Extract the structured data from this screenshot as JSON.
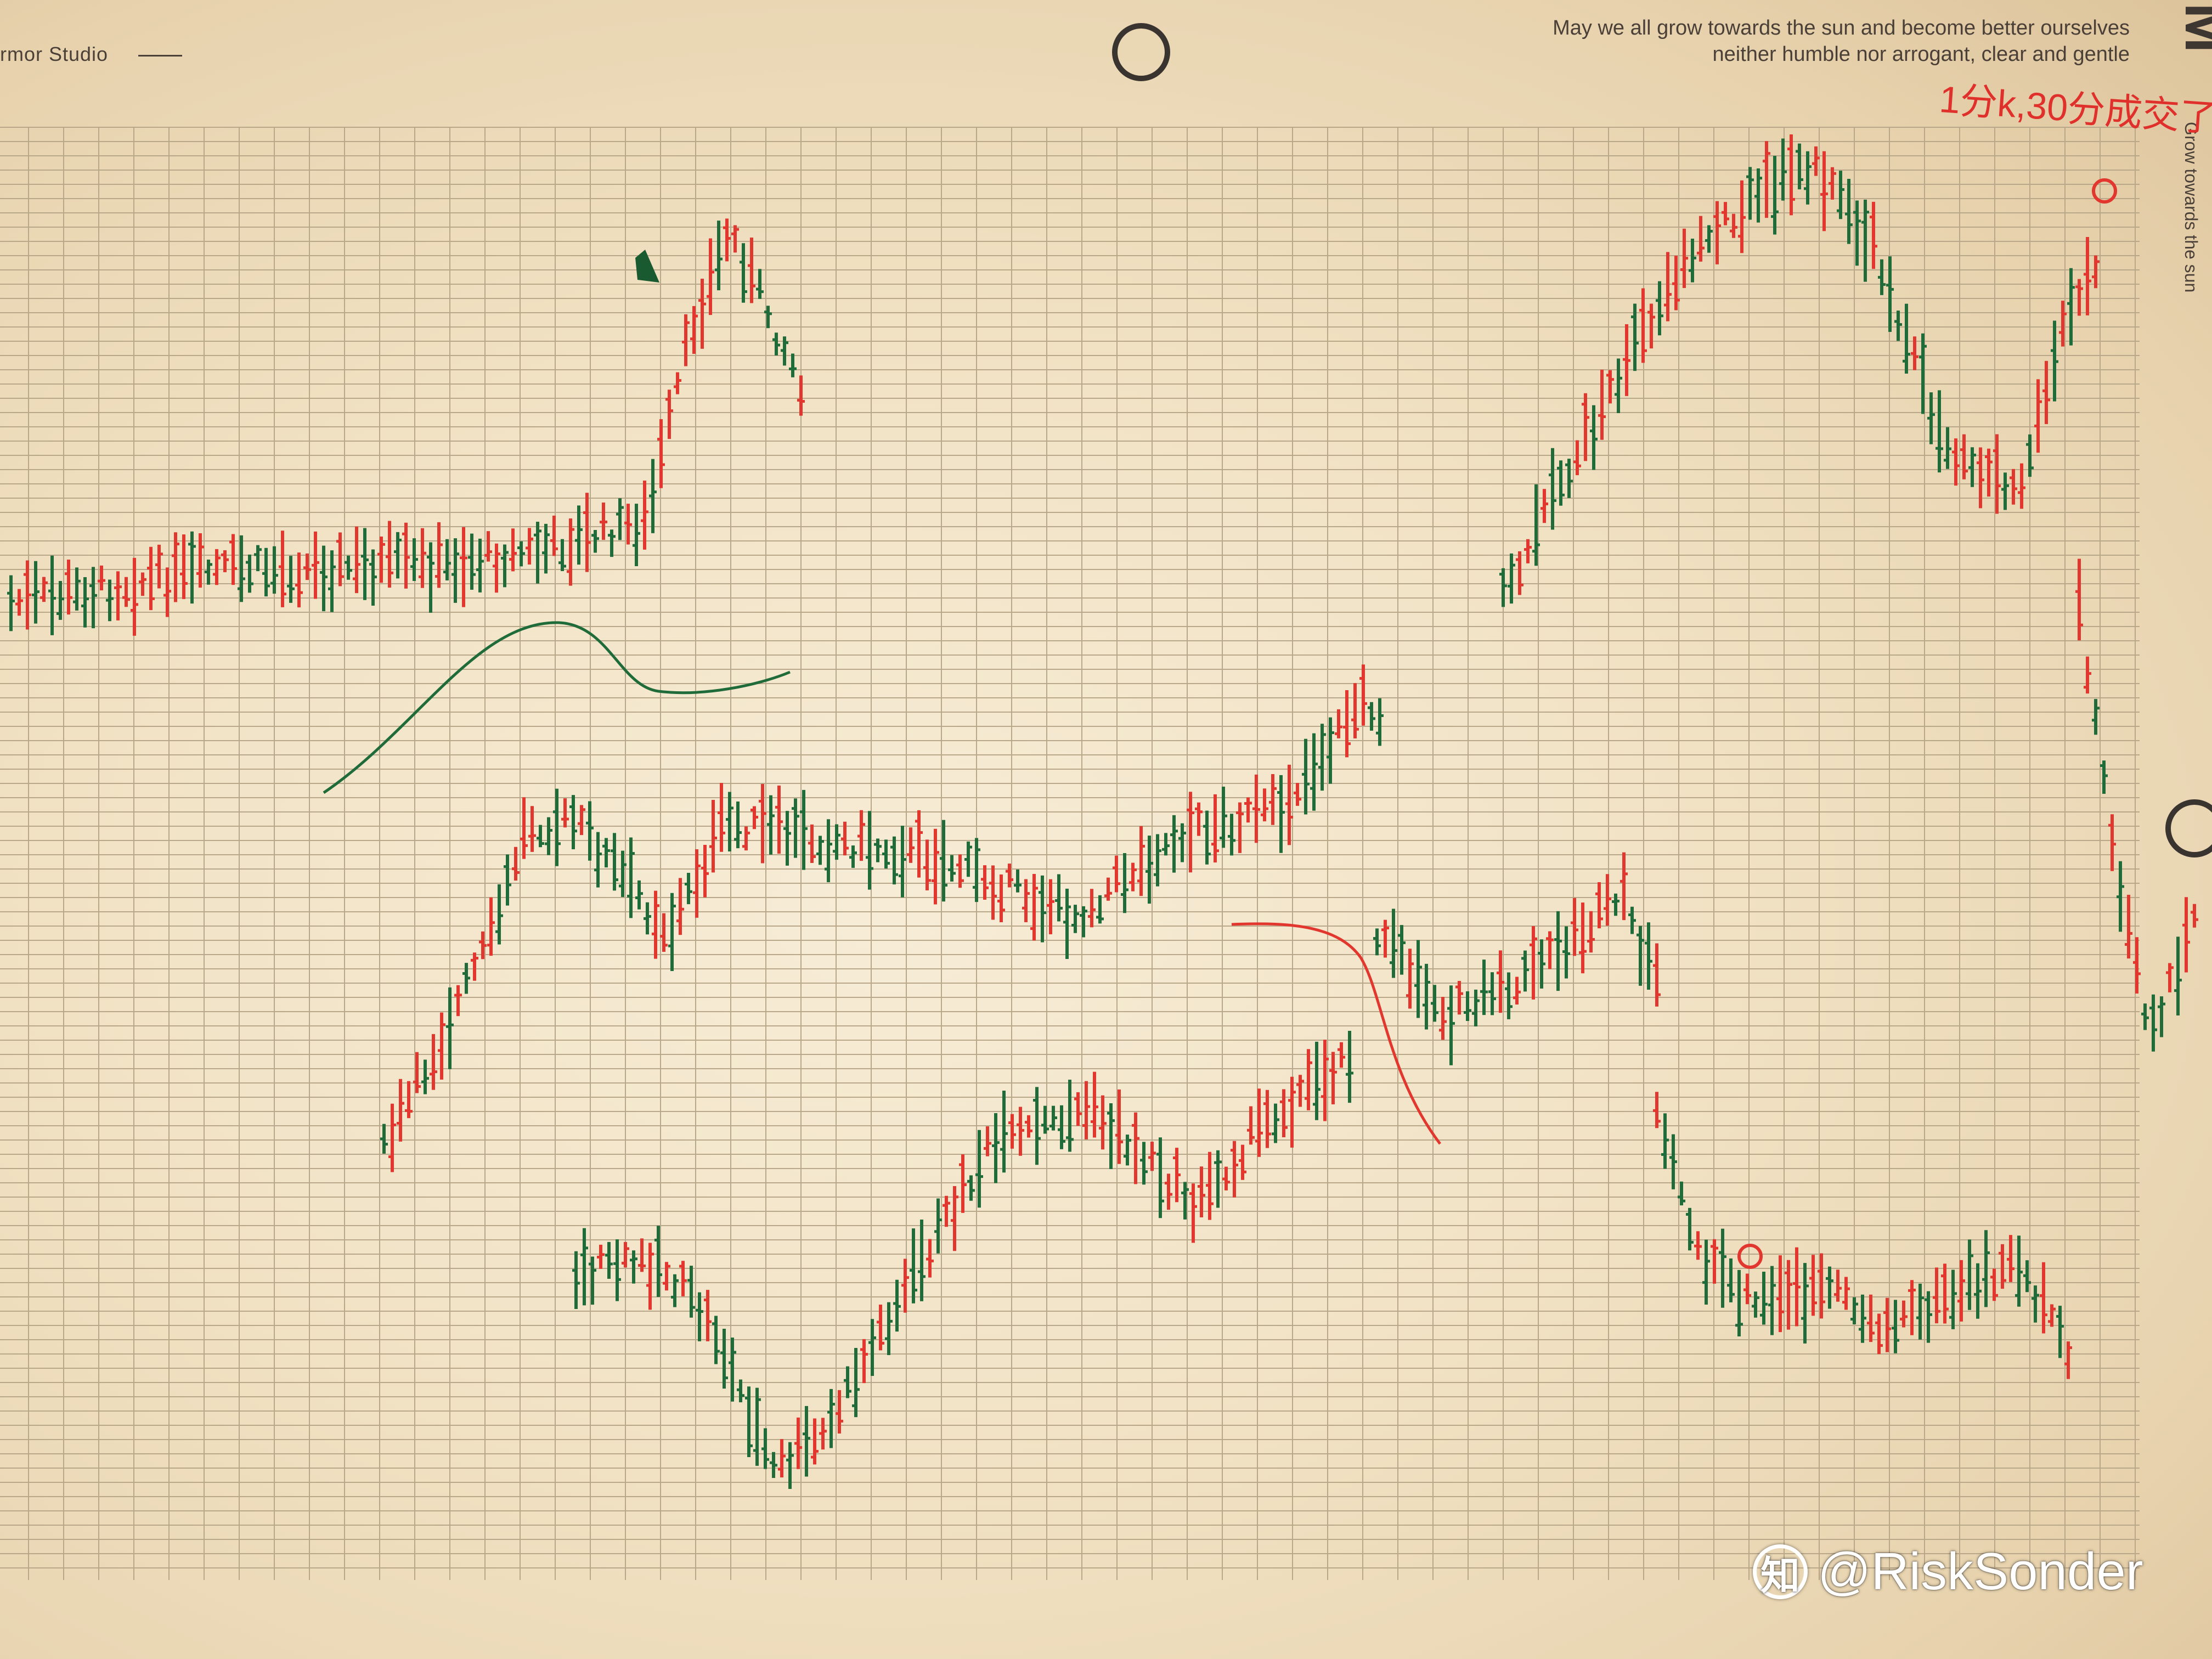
{
  "paper": {
    "studio_label": "rmor Studio",
    "motto_line_1": "May we all grow towards the sun and become better ourselves",
    "motto_line_2": "neither humble nor arrogant, clear and gentle",
    "side_text": "Grow towards the sun",
    "corner_letter": "M",
    "grid_line_color": "#b9a789",
    "paper_color": "#f4e7cc"
  },
  "annotations": {
    "handwritten_note": "1分k,30分成交了、",
    "note_color": "#e0302c"
  },
  "watermark": {
    "icon": "zhihu-logo-icon",
    "text": "@RiskSonder"
  },
  "ink_colors": {
    "up": "#e2372e",
    "down": "#1f6b3a"
  }
}
